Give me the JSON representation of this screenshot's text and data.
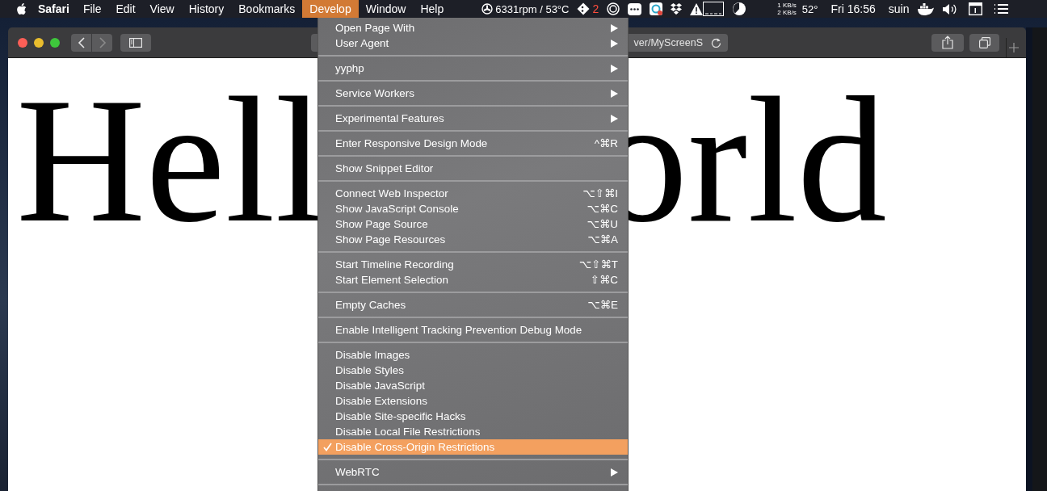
{
  "menu_bar": {
    "app_name": "Safari",
    "menus": [
      {
        "label": "File",
        "selected": false
      },
      {
        "label": "Edit",
        "selected": false
      },
      {
        "label": "View",
        "selected": false
      },
      {
        "label": "History",
        "selected": false
      },
      {
        "label": "Bookmarks",
        "selected": false
      },
      {
        "label": "Develop",
        "selected": true
      },
      {
        "label": "Window",
        "selected": false
      },
      {
        "label": "Help",
        "selected": false
      }
    ],
    "status": {
      "fan_reading": "6331rpm / 53°C",
      "git_count": "2",
      "upload_rate": "1 KB/s",
      "download_rate": "2 KB/s",
      "temperature": "52°",
      "clock": "Fri 16:56",
      "user": "suin"
    }
  },
  "browser": {
    "address_fragment": "ver/MyScreenS",
    "page_text_parts": [
      "Hell",
      "orld"
    ]
  },
  "develop_menu": {
    "groups": [
      [
        {
          "label": "Open Page With",
          "submenu": true,
          "checked": false,
          "selected": false
        },
        {
          "label": "User Agent",
          "submenu": true,
          "checked": false,
          "selected": false
        }
      ],
      [
        {
          "label": "yyphp",
          "submenu": true,
          "checked": false,
          "selected": false
        }
      ],
      [
        {
          "label": "Service Workers",
          "submenu": true,
          "checked": false,
          "selected": false
        }
      ],
      [
        {
          "label": "Experimental Features",
          "submenu": true,
          "checked": false,
          "selected": false
        }
      ],
      [
        {
          "label": "Enter Responsive Design Mode",
          "shortcut": "^⌘R",
          "submenu": false,
          "checked": false,
          "selected": false
        }
      ],
      [
        {
          "label": "Show Snippet Editor",
          "submenu": false,
          "checked": false,
          "selected": false
        }
      ],
      [
        {
          "label": "Connect Web Inspector",
          "shortcut": "⌥⇧⌘I",
          "submenu": false,
          "checked": false,
          "selected": false
        },
        {
          "label": "Show JavaScript Console",
          "shortcut": "⌥⌘C",
          "submenu": false,
          "checked": false,
          "selected": false
        },
        {
          "label": "Show Page Source",
          "shortcut": "⌥⌘U",
          "submenu": false,
          "checked": false,
          "selected": false
        },
        {
          "label": "Show Page Resources",
          "shortcut": "⌥⌘A",
          "submenu": false,
          "checked": false,
          "selected": false
        }
      ],
      [
        {
          "label": "Start Timeline Recording",
          "shortcut": "⌥⇧⌘T",
          "submenu": false,
          "checked": false,
          "selected": false
        },
        {
          "label": "Start Element Selection",
          "shortcut": "⇧⌘C",
          "submenu": false,
          "checked": false,
          "selected": false
        }
      ],
      [
        {
          "label": "Empty Caches",
          "shortcut": "⌥⌘E",
          "submenu": false,
          "checked": false,
          "selected": false
        }
      ],
      [
        {
          "label": "Enable Intelligent Tracking Prevention Debug Mode",
          "submenu": false,
          "checked": false,
          "selected": false
        }
      ],
      [
        {
          "label": "Disable Images",
          "submenu": false,
          "checked": false,
          "selected": false
        },
        {
          "label": "Disable Styles",
          "submenu": false,
          "checked": false,
          "selected": false
        },
        {
          "label": "Disable JavaScript",
          "submenu": false,
          "checked": false,
          "selected": false
        },
        {
          "label": "Disable Extensions",
          "submenu": false,
          "checked": false,
          "selected": false
        },
        {
          "label": "Disable Site-specific Hacks",
          "submenu": false,
          "checked": false,
          "selected": false
        },
        {
          "label": "Disable Local File Restrictions",
          "submenu": false,
          "checked": false,
          "selected": false
        },
        {
          "label": "Disable Cross-Origin Restrictions",
          "submenu": false,
          "checked": true,
          "selected": true
        }
      ],
      [
        {
          "label": "WebRTC",
          "submenu": true,
          "checked": false,
          "selected": false
        }
      ]
    ]
  }
}
